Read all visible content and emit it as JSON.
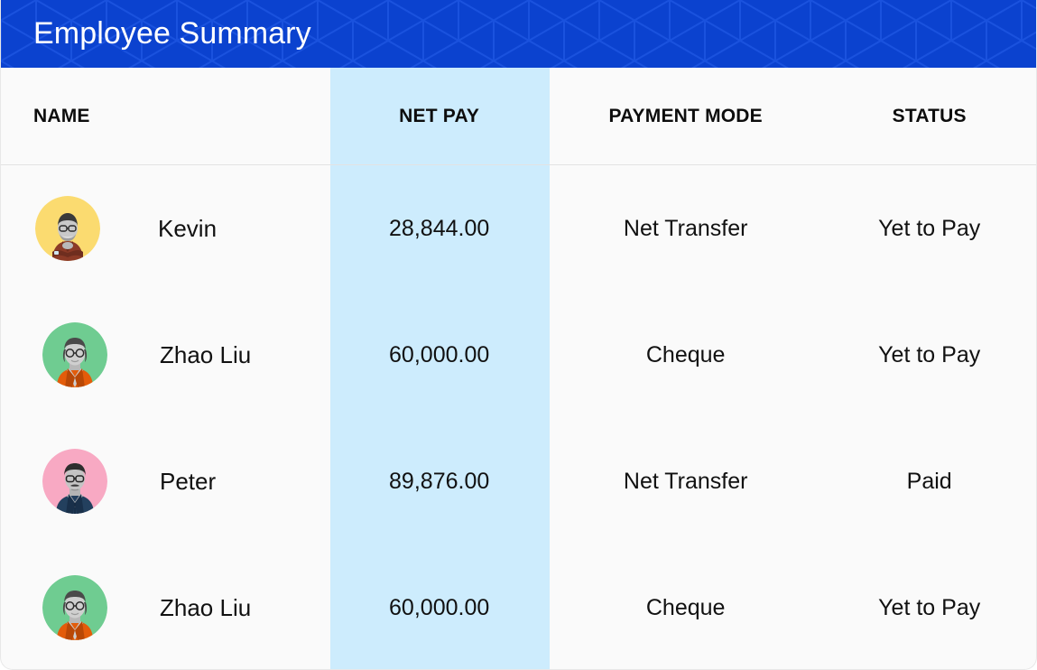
{
  "header": {
    "title": "Employee Summary",
    "background_color": "#0b42cf",
    "pattern_color": "#1a52de",
    "title_color": "#ffffff",
    "pattern_name": "isometric-cube-pattern"
  },
  "table": {
    "highlight_color": "#cdecfd",
    "highlighted_column": "NET PAY",
    "columns": [
      {
        "key": "name",
        "label": "NAME"
      },
      {
        "key": "pay",
        "label": "NET PAY"
      },
      {
        "key": "mode",
        "label": "PAYMENT MODE"
      },
      {
        "key": "status",
        "label": "STATUS"
      }
    ],
    "rows": [
      {
        "name": "Kevin",
        "pay": "28,844.00",
        "mode": "Net Transfer",
        "status": "Yet to Pay",
        "avatar": {
          "name": "avatar-kevin",
          "bg": "#fbdb70",
          "shirt": "#8c3b27",
          "shirt_dark": "#6f2e1f",
          "skin": "#c9c9c9",
          "hair": "#3a3a3a"
        }
      },
      {
        "name": "Zhao Liu",
        "pay": "60,000.00",
        "mode": "Cheque",
        "status": "Yet to Pay",
        "avatar": {
          "name": "avatar-zhao-liu",
          "bg": "#6fcc91",
          "shirt": "#e35c0a",
          "shirt_dark": "#b94806",
          "skin": "#cfcfcf",
          "hair": "#4a4a4a"
        }
      },
      {
        "name": "Peter",
        "pay": "89,876.00",
        "mode": "Net Transfer",
        "status": "Paid",
        "avatar": {
          "name": "avatar-peter",
          "bg": "#f8a9c3",
          "shirt": "#23405e",
          "shirt_dark": "#19304a",
          "skin": "#c4c4c4",
          "hair": "#2e2e2e"
        }
      },
      {
        "name": "Zhao Liu",
        "pay": "60,000.00",
        "mode": "Cheque",
        "status": "Yet to Pay",
        "avatar": {
          "name": "avatar-zhao-liu-2",
          "bg": "#6fcc91",
          "shirt": "#e35c0a",
          "shirt_dark": "#b94806",
          "skin": "#cfcfcf",
          "hair": "#4a4a4a"
        }
      }
    ]
  }
}
